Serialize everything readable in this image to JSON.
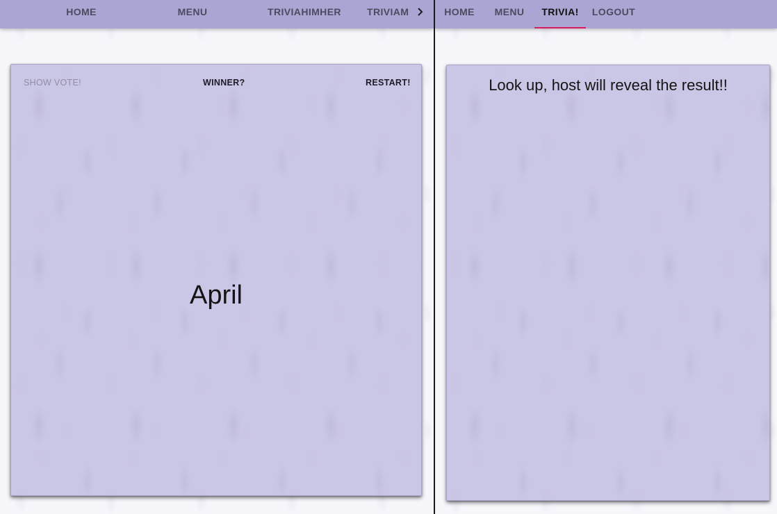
{
  "host_view": {
    "tabs": [
      "HOME",
      "MENU",
      "TRIVIAHIMHER",
      "TRIVIAM"
    ],
    "card": {
      "show_vote_label": "SHOW VOTE!",
      "winner_label": "WINNER?",
      "restart_label": "RESTART!",
      "answer": "April"
    }
  },
  "player_view": {
    "tabs": [
      "HOME",
      "MENU",
      "TRIVIA!",
      "LOGOUT"
    ],
    "active_tab": "TRIVIA!",
    "message": "Look up, host will reveal the result!!"
  },
  "colors": {
    "appbar": "#a9a6d3",
    "card": "#c7c3e4",
    "tab_indicator": "#d81b60"
  },
  "icons": {
    "scroll_right": "chevron-right-icon"
  }
}
